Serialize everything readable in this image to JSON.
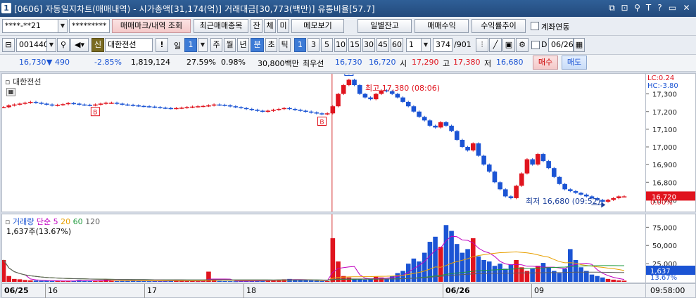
{
  "window": {
    "number": "1",
    "title": "[0606] 자동일지차트(매매내역) - 시가총액[31,174(억)] 거래대금[30,773(백만)] 유통비율[57.7]",
    "controls": [
      "⧉",
      "⊡",
      "⚲",
      "T",
      "?",
      "▭",
      "✕"
    ]
  },
  "toolbar1": {
    "account": "****-**21",
    "password": "*********",
    "btn_trade_marks": "매매마크/내역 조회",
    "btn_recent": "최근매매종목",
    "btn_jan": "잔",
    "btn_che": "체",
    "btn_mi": "미",
    "btn_memo": "메모보기",
    "btn_daily_balance": "일별잔고",
    "btn_trade_profit": "매매수익",
    "btn_return_trend": "수익률추이",
    "chk_account_link": "계좌연동"
  },
  "toolbar2": {
    "stock_code": "001440",
    "credit_badge": "신",
    "stock_name": "대한전선",
    "alert_btn": "!",
    "period_label": "일",
    "period_value": "1",
    "period_tabs": [
      "주",
      "월",
      "년",
      "분",
      "초",
      "틱"
    ],
    "period_selected": "분",
    "minute_values": [
      "1",
      "3",
      "5",
      "10",
      "15",
      "30",
      "45",
      "60"
    ],
    "minute_selected": "1",
    "custom_value": "1",
    "count": "374",
    "total": "/901",
    "chk_d": "D",
    "date": "06/26"
  },
  "quote": {
    "price": "16,730",
    "change": "490",
    "change_pct": "-2.85%",
    "volume": "1,819,124",
    "turnover_pct": "27.59%",
    "ratio": "0.98%",
    "amount": "30,800백만",
    "best_label": "최우선",
    "best_ask": "16,730",
    "best_bid": "16,720",
    "open_label": "시",
    "open": "17,290",
    "high_label": "고",
    "high": "17,380",
    "low_label": "저",
    "low": "16,680",
    "buy_btn": "매수",
    "sell_btn": "매도"
  },
  "price_pane": {
    "title": "대한전선",
    "high_annotation": "최고 17,380 (08:06)",
    "low_annotation": "최저 16,680 (09:52)",
    "lc": "LC:0.24",
    "hc": "HC:-3.80",
    "current_label": "16,720",
    "current_pct": "0.00%",
    "buy_marker": "B",
    "sell_marker": "S",
    "y_ticks": [
      "17,300",
      "17,200",
      "17,100",
      "17,000",
      "16,900",
      "16,800",
      "16,700"
    ]
  },
  "volume_pane": {
    "legend_title": "거래량",
    "legend_ma": "단순",
    "legend_periods": [
      "5",
      "20",
      "60",
      "120"
    ],
    "legend_colors": [
      "#c000c0",
      "#e8a000",
      "#1e9a3c",
      "#606060"
    ],
    "current": "1,637주(13.67%)",
    "current_label": "1,637",
    "current_pct": "13.67%",
    "y_ticks": [
      "75,000",
      "50,000",
      "25,000"
    ]
  },
  "date_axis": {
    "labels": [
      "06/25",
      "16",
      "17",
      "18",
      "06/26",
      "09"
    ],
    "time": "09:58:00"
  },
  "chart_data": {
    "type": "line",
    "title": "대한전선",
    "ylabel": "",
    "ylim": [
      16650,
      17390
    ],
    "x_labels": [
      "06/25",
      "16",
      "17",
      "18",
      "06/26",
      "09"
    ],
    "series": [
      {
        "name": "대한전선",
        "note": "per-minute prices, approximate, read from chart",
        "values": [
          17225,
          17235,
          17240,
          17245,
          17250,
          17255,
          17250,
          17245,
          17240,
          17235,
          17238,
          17242,
          17248,
          17245,
          17240,
          17238,
          17236,
          17240,
          17245,
          17250,
          17250,
          17245,
          17240,
          17238,
          17235,
          17232,
          17230,
          17228,
          17225,
          17222,
          17220,
          17218,
          17220,
          17222,
          17225,
          17228,
          17230,
          17232,
          17235,
          17240,
          17238,
          17235,
          17230,
          17225,
          17220,
          17215,
          17210,
          17205,
          17200,
          17205,
          17210,
          17215,
          17220,
          17215,
          17210,
          17205,
          17200,
          17195,
          17190,
          17185,
          17190,
          17230,
          17300,
          17350,
          17380,
          17350,
          17300,
          17280,
          17270,
          17300,
          17320,
          17315,
          17300,
          17280,
          17255,
          17230,
          17200,
          17170,
          17150,
          17120,
          17110,
          17140,
          17120,
          17090,
          17040,
          17000,
          16980,
          17020,
          16950,
          16900,
          16860,
          16800,
          16760,
          16720,
          16710,
          16780,
          16850,
          16930,
          16900,
          16960,
          16920,
          16880,
          16830,
          16790,
          16760,
          16750,
          16740,
          16730,
          16720,
          16710,
          16700,
          16690,
          16700,
          16710,
          16720,
          16720
        ]
      }
    ],
    "volume_ylim": [
      0,
      85000
    ],
    "volume_values": [
      30000,
      8000,
      4000,
      3500,
      2500,
      2000,
      1800,
      1500,
      1500,
      1200,
      1200,
      1000,
      1000,
      1500,
      2500,
      1800,
      1200,
      1200,
      1800,
      3000,
      1500,
      1200,
      1500,
      1800,
      2500,
      1200,
      1000,
      900,
      1200,
      1500,
      1800,
      2000,
      2200,
      1500,
      1200,
      1000,
      900,
      1500,
      14000,
      1800,
      1200,
      1000,
      900,
      800,
      1000,
      1200,
      1500,
      1800,
      2000,
      2200,
      2500,
      3000,
      3500,
      4000,
      3000,
      2500,
      2000,
      1800,
      1500,
      1200,
      1000,
      60000,
      28000,
      8000,
      6000,
      4000,
      3500,
      3000,
      4500,
      7000,
      6000,
      4500,
      8000,
      12000,
      15000,
      25000,
      32000,
      28000,
      40000,
      55000,
      62000,
      48000,
      78000,
      70000,
      52000,
      40000,
      45000,
      60000,
      35000,
      30000,
      28000,
      22000,
      25000,
      18000,
      24000,
      30000,
      20000,
      15000,
      18000,
      22000,
      26000,
      20000,
      15000,
      12000,
      18000,
      45000,
      30000,
      20000,
      15000,
      10000,
      8000,
      6000,
      4000,
      3000,
      2000,
      1637
    ]
  }
}
